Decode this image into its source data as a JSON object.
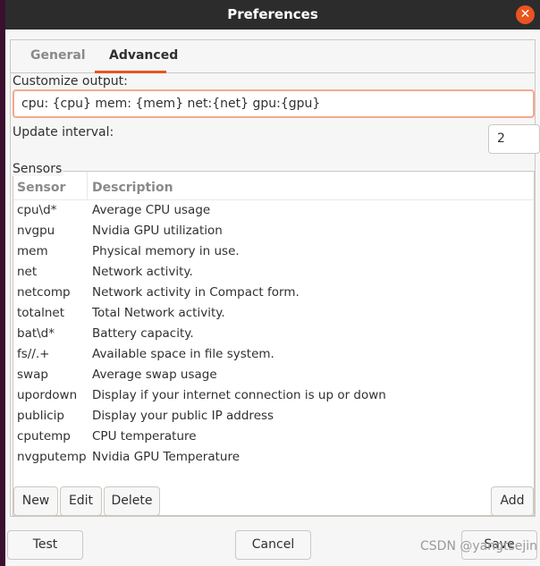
{
  "window": {
    "title": "Preferences",
    "close_icon": "close-icon",
    "accent": "#e95420"
  },
  "tabs": [
    {
      "label": "General",
      "active": false
    },
    {
      "label": "Advanced",
      "active": true
    }
  ],
  "advanced": {
    "customize_label": "Customize output:",
    "customize_value": "cpu: {cpu} mem: {mem} net:{net} gpu:{gpu}",
    "interval_label": "Update interval:",
    "interval_value": "2",
    "sensors_label": "Sensors",
    "columns": [
      "Sensor",
      "Description"
    ],
    "rows": [
      [
        "cpu\\d*",
        "Average CPU usage"
      ],
      [
        "nvgpu",
        "Nvidia GPU utilization"
      ],
      [
        "mem",
        "Physical memory in use."
      ],
      [
        "net",
        "Network activity."
      ],
      [
        "netcomp",
        "Network activity in Compact form."
      ],
      [
        "totalnet",
        "Total Network activity."
      ],
      [
        "bat\\d*",
        "Battery capacity."
      ],
      [
        "fs//.+",
        "Available space in file system."
      ],
      [
        "swap",
        "Average swap usage"
      ],
      [
        "upordown",
        "Display if your internet connection is up or down"
      ],
      [
        "publicip",
        "Display your public IP address"
      ],
      [
        "cputemp",
        "CPU temperature"
      ],
      [
        "nvgputemp",
        "Nvidia GPU Temperature"
      ]
    ],
    "new_label": "New",
    "edit_label": "Edit",
    "delete_label": "Delete",
    "add_label": "Add"
  },
  "footer": {
    "test_label": "Test",
    "cancel_label": "Cancel",
    "save_label": "Save"
  },
  "watermark": "CSDN @yangtsejin"
}
